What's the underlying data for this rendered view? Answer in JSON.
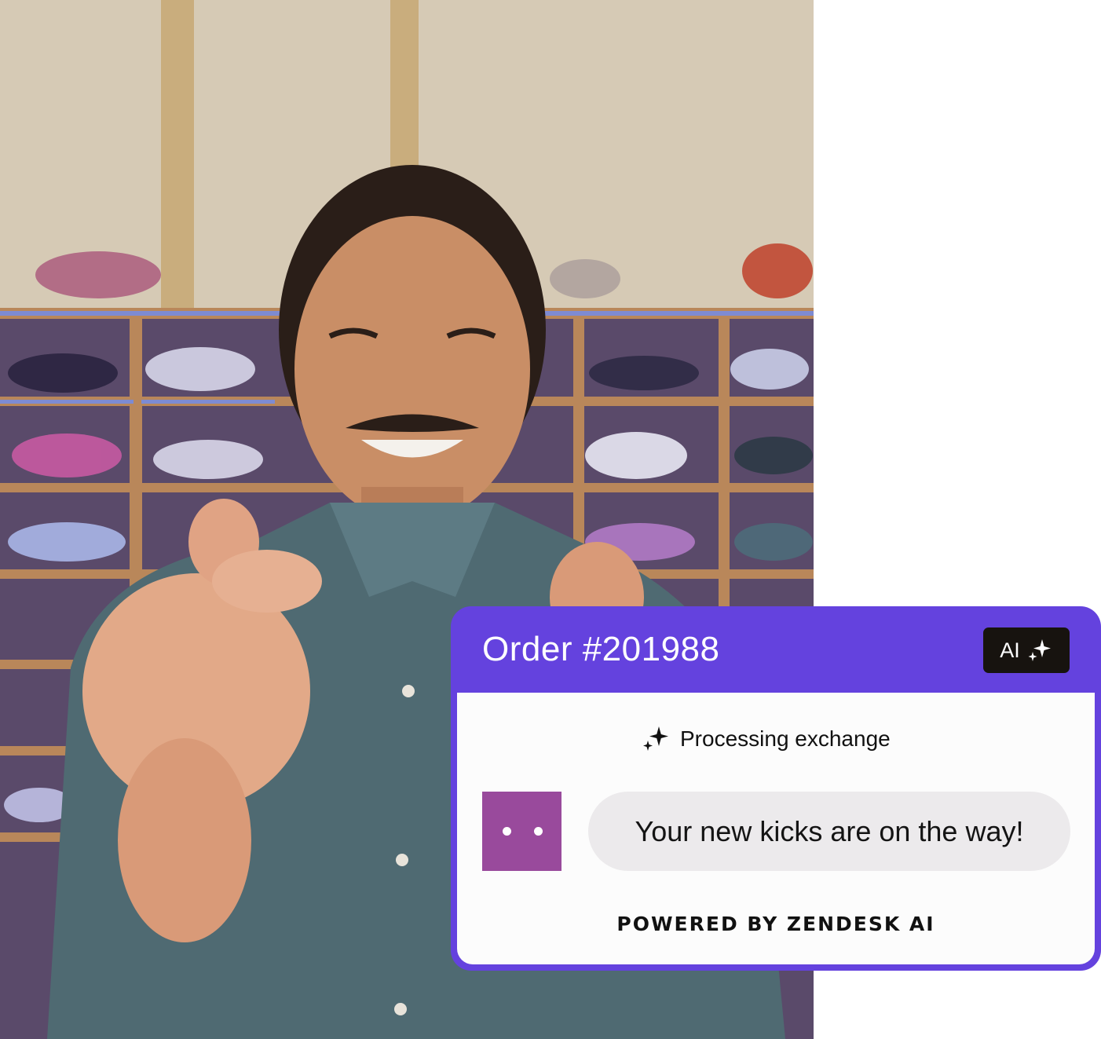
{
  "colors": {
    "card_header": "#6442de",
    "ai_badge_bg": "#17130f",
    "avatar": "#994a9c",
    "bubble_bg": "#eceaec"
  },
  "photo": {
    "subject": "smiling man making finger-heart gesture in sneaker store"
  },
  "order_card": {
    "title": "Order #201988",
    "ai_badge_label": "AI",
    "ai_badge_icon": "sparkle-icon",
    "status_icon": "sparkle-icon",
    "status_text": "Processing exchange",
    "bot_avatar_icon": "bot-face-icon",
    "message": "Your new kicks are on the way!",
    "footer": "POWERED BY ZENDESK AI"
  }
}
